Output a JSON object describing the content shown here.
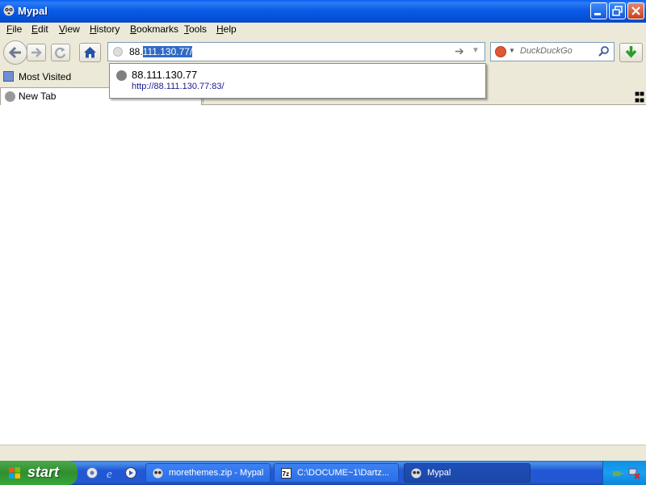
{
  "window": {
    "title": "Mypal",
    "controls": {
      "minimize": "minimize-icon",
      "maximize": "restore-icon",
      "close": "close-icon"
    }
  },
  "menu": {
    "items": [
      {
        "label": "File",
        "accel": "F",
        "rest": "ile"
      },
      {
        "label": "Edit",
        "accel": "E",
        "rest": "dit"
      },
      {
        "label": "View",
        "accel": "V",
        "rest": "iew"
      },
      {
        "label": "History",
        "accel": "H",
        "rest": "istory"
      },
      {
        "label": "Bookmarks",
        "accel": "B",
        "rest": "ookmarks"
      },
      {
        "label": "Tools",
        "accel": "T",
        "rest": "ools"
      },
      {
        "label": "Help",
        "accel": "H",
        "rest": "elp"
      }
    ]
  },
  "navbar": {
    "url_typed": "88.",
    "url_selected": "111.130.77/",
    "search_placeholder": "DuckDuckGo"
  },
  "autocomplete": {
    "title": "88.111.130.77",
    "url": "http://88.111.130.77:83/"
  },
  "bookmarks": {
    "most_visited": "Most Visited"
  },
  "tabs": [
    {
      "label": "New Tab"
    }
  ],
  "taskbar": {
    "start_label": "start",
    "tasks": [
      {
        "label": "morethemes.zip - Mypal",
        "active": false
      },
      {
        "label": "C:\\DOCUME~1\\Dartz...",
        "active": false
      },
      {
        "label": "Mypal",
        "active": true
      }
    ]
  },
  "colors": {
    "titlebar": "#0a5be6",
    "chrome": "#ece9d8",
    "selection": "#316ac5",
    "taskbar": "#2457d0",
    "start": "#36a836",
    "tray": "#1a9ef0"
  }
}
